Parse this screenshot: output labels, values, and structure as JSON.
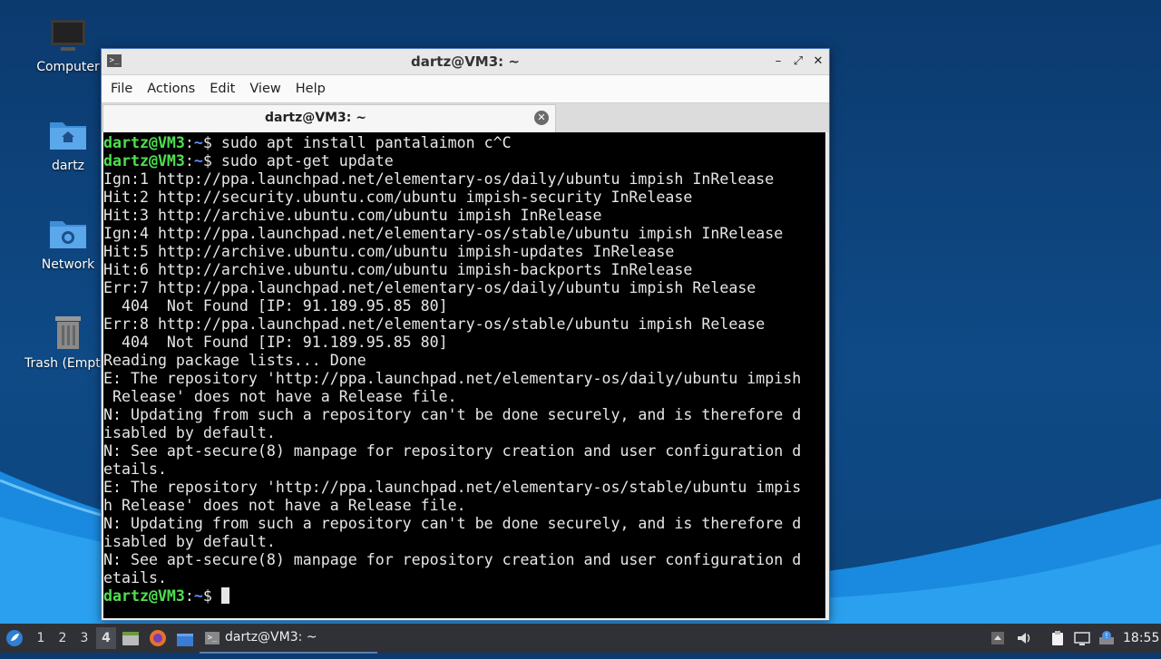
{
  "desktop": {
    "icons": [
      {
        "label": "Computer"
      },
      {
        "label": "dartz"
      },
      {
        "label": "Network"
      },
      {
        "label": "Trash (Empty)"
      }
    ]
  },
  "window": {
    "title": "dartz@VM3: ~",
    "menu": [
      "File",
      "Actions",
      "Edit",
      "View",
      "Help"
    ],
    "tab_label": "dartz@VM3: ~"
  },
  "terminal": {
    "prompt_user": "dartz@VM3",
    "prompt_path": "~",
    "lines": [
      {
        "type": "prompt",
        "cmd": "$ sudo apt install pantalaimon c^C"
      },
      {
        "type": "prompt",
        "cmd": "$ sudo apt-get update"
      },
      {
        "type": "out",
        "text": "Ign:1 http://ppa.launchpad.net/elementary-os/daily/ubuntu impish InRelease"
      },
      {
        "type": "out",
        "text": "Hit:2 http://security.ubuntu.com/ubuntu impish-security InRelease"
      },
      {
        "type": "out",
        "text": "Hit:3 http://archive.ubuntu.com/ubuntu impish InRelease"
      },
      {
        "type": "out",
        "text": "Ign:4 http://ppa.launchpad.net/elementary-os/stable/ubuntu impish InRelease"
      },
      {
        "type": "out",
        "text": "Hit:5 http://archive.ubuntu.com/ubuntu impish-updates InRelease"
      },
      {
        "type": "out",
        "text": "Hit:6 http://archive.ubuntu.com/ubuntu impish-backports InRelease"
      },
      {
        "type": "out",
        "text": "Err:7 http://ppa.launchpad.net/elementary-os/daily/ubuntu impish Release"
      },
      {
        "type": "out",
        "text": "  404  Not Found [IP: 91.189.95.85 80]"
      },
      {
        "type": "out",
        "text": "Err:8 http://ppa.launchpad.net/elementary-os/stable/ubuntu impish Release"
      },
      {
        "type": "out",
        "text": "  404  Not Found [IP: 91.189.95.85 80]"
      },
      {
        "type": "out",
        "text": "Reading package lists... Done"
      },
      {
        "type": "out",
        "text": "E: The repository 'http://ppa.launchpad.net/elementary-os/daily/ubuntu impish"
      },
      {
        "type": "out",
        "text": " Release' does not have a Release file."
      },
      {
        "type": "out",
        "text": "N: Updating from such a repository can't be done securely, and is therefore d"
      },
      {
        "type": "out",
        "text": "isabled by default."
      },
      {
        "type": "out",
        "text": "N: See apt-secure(8) manpage for repository creation and user configuration d"
      },
      {
        "type": "out",
        "text": "etails."
      },
      {
        "type": "out",
        "text": "E: The repository 'http://ppa.launchpad.net/elementary-os/stable/ubuntu impis"
      },
      {
        "type": "out",
        "text": "h Release' does not have a Release file."
      },
      {
        "type": "out",
        "text": "N: Updating from such a repository can't be done securely, and is therefore d"
      },
      {
        "type": "out",
        "text": "isabled by default."
      },
      {
        "type": "out",
        "text": "N: See apt-secure(8) manpage for repository creation and user configuration d"
      },
      {
        "type": "out",
        "text": "etails."
      },
      {
        "type": "prompt",
        "cmd": "$ ",
        "cursor": true
      }
    ]
  },
  "taskbar": {
    "workspaces": [
      "1",
      "2",
      "3",
      "4"
    ],
    "active_workspace": "4",
    "task_label": "dartz@VM3: ~",
    "clock": "18:55"
  },
  "colors": {
    "prompt_user": "#4ee04e",
    "prompt_path": "#5c8cff",
    "terminal_bg": "#000000"
  }
}
